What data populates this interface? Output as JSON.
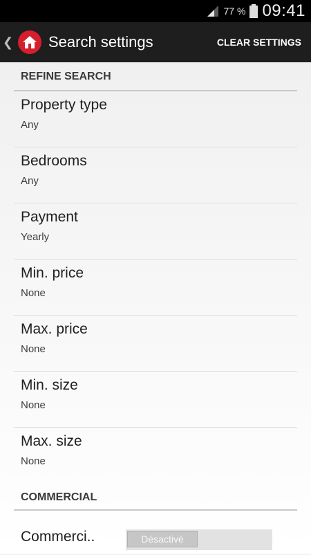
{
  "status_bar": {
    "battery_percent": "77 %",
    "time": "09:41",
    "signal_icon": "signal-icon",
    "battery_icon": "battery-icon"
  },
  "action_bar": {
    "back_icon": "chevron-left-icon",
    "logo_icon": "house-icon",
    "title": "Search settings",
    "clear_label": "CLEAR SETTINGS",
    "logo_color": "#d51f2f",
    "background_color": "#1e1e1e"
  },
  "sections": {
    "refine": {
      "header": "REFINE SEARCH",
      "items": [
        {
          "title": "Property type",
          "summary": "Any"
        },
        {
          "title": "Bedrooms",
          "summary": "Any"
        },
        {
          "title": "Payment",
          "summary": "Yearly"
        },
        {
          "title": "Min. price",
          "summary": "None"
        },
        {
          "title": "Max. price",
          "summary": "None"
        },
        {
          "title": "Min. size",
          "summary": "None"
        },
        {
          "title": "Max. size",
          "summary": "None"
        }
      ]
    },
    "commercial": {
      "header": "COMMERCIAL",
      "toggle": {
        "label": "Commerci..",
        "state_label": "Désactivé",
        "enabled": false
      }
    }
  }
}
